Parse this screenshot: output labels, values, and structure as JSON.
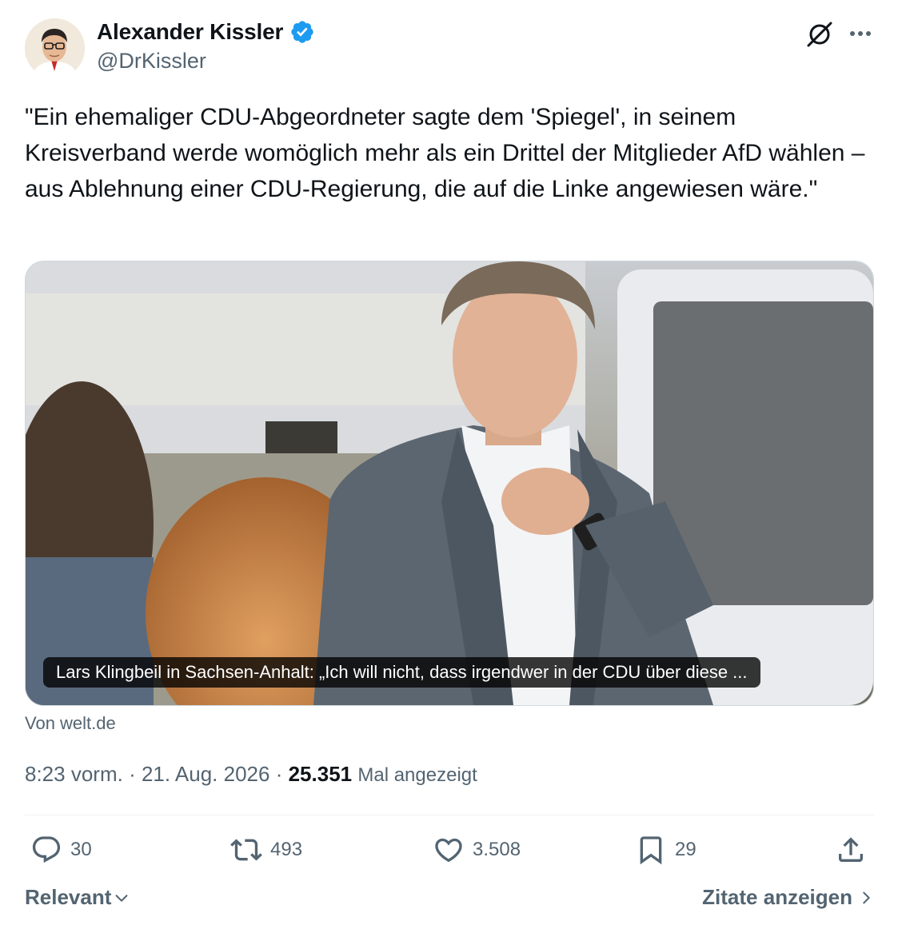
{
  "author": {
    "name": "Alexander Kissler",
    "handle": "@DrKissler"
  },
  "tweet": {
    "text": "\"Ein ehemaliger CDU-Abgeordneter sagte dem 'Spiegel', in seinem Kreisverband werde womöglich mehr als ein Drittel der Mitglieder AfD wählen – aus Ablehnung einer CDU-Regierung, die auf die Linke angewiesen wäre.\""
  },
  "media": {
    "caption": "Lars Klingbeil in Sachsen-Anhalt: „Ich will nicht, dass irgendwer in der CDU über diese ...",
    "source": "Von welt.de"
  },
  "meta": {
    "time": "8:23 vorm.",
    "separator": "·",
    "date": "21. Aug. 2026",
    "views": "25.351",
    "views_label": "Mal angezeigt"
  },
  "actions": {
    "replies": "30",
    "reposts": "493",
    "likes": "3.508",
    "bookmarks": "29"
  },
  "footer": {
    "sort_label": "Relevant",
    "quotes_label": "Zitate anzeigen"
  },
  "colors": {
    "verified": "#1d9bf0",
    "text_primary": "#0f1419",
    "text_secondary": "#536471",
    "border": "#cfd9de"
  }
}
